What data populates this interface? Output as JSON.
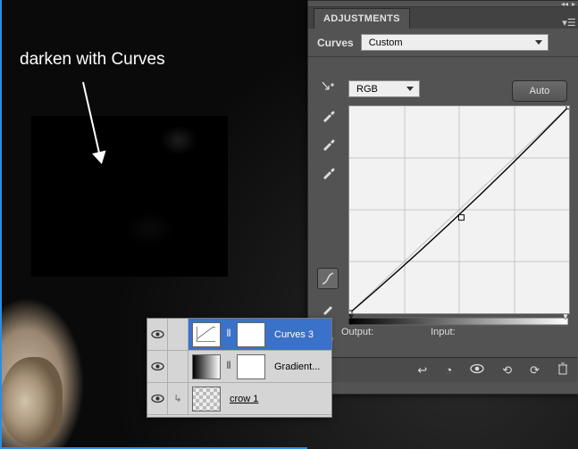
{
  "annotation": {
    "text": "darken with Curves"
  },
  "panel": {
    "tab": "ADJUSTMENTS",
    "section_label": "Curves",
    "preset": "Custom",
    "channel": "RGB",
    "auto_label": "Auto",
    "output_label": "Output:",
    "input_label": "Input:"
  },
  "tools": {
    "targeted": "targeted-adjust",
    "eyedroppers": [
      "eyedropper-black",
      "eyedropper-gray",
      "eyedropper-white"
    ],
    "mode_curve": "curve-mode",
    "mode_pencil": "pencil-mode",
    "mode_smooth": "smooth-mode"
  },
  "footer_icons": [
    "return-icon",
    "circle-icon",
    "eye-icon",
    "refresh-back-icon",
    "refresh-icon",
    "trash-icon"
  ],
  "layers": [
    {
      "name": "Curves 3",
      "kind": "curves",
      "selected": true
    },
    {
      "name": "Gradient...",
      "kind": "gradient",
      "selected": false
    },
    {
      "name": "crow 1",
      "kind": "image",
      "selected": false
    }
  ],
  "chart_data": {
    "type": "line",
    "title": "Curves",
    "xlabel": "Input",
    "ylabel": "Output",
    "xlim": [
      0,
      255
    ],
    "ylim": [
      0,
      255
    ],
    "grid": true,
    "series": [
      {
        "name": "RGB",
        "values": [
          [
            0,
            0
          ],
          [
            130,
            118
          ],
          [
            255,
            255
          ]
        ]
      }
    ]
  }
}
